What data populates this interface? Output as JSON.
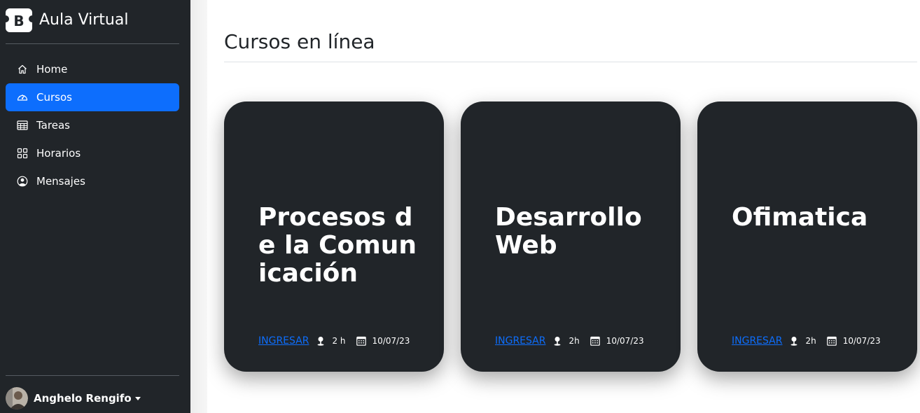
{
  "sidebar": {
    "brand": {
      "logo_letter": "B",
      "title": "Aula Virtual"
    },
    "items": [
      {
        "label": "Home",
        "icon": "home-icon",
        "active": false
      },
      {
        "label": "Cursos",
        "icon": "speedometer-icon",
        "active": true
      },
      {
        "label": "Tareas",
        "icon": "table-icon",
        "active": false
      },
      {
        "label": "Horarios",
        "icon": "grid-icon",
        "active": false
      },
      {
        "label": "Mensajes",
        "icon": "person-circle-icon",
        "active": false
      }
    ],
    "user": {
      "name": "Anghelo Rengifo"
    }
  },
  "main": {
    "title": "Cursos en línea",
    "cards": [
      {
        "title": "Procesos de la Comunicación",
        "link": "INGRESAR",
        "duration": "2 h",
        "date": "10/07/23"
      },
      {
        "title": "Desarrollo Web",
        "link": "INGRESAR",
        "duration": "2h",
        "date": "10/07/23"
      },
      {
        "title": "Ofimatica",
        "link": "INGRESAR",
        "duration": "2h",
        "date": "10/07/23"
      }
    ]
  },
  "colors": {
    "sidebar_bg": "#212529",
    "accent": "#0d6efd",
    "card_bg": "#212529",
    "brand_logo": "#ffffff"
  }
}
